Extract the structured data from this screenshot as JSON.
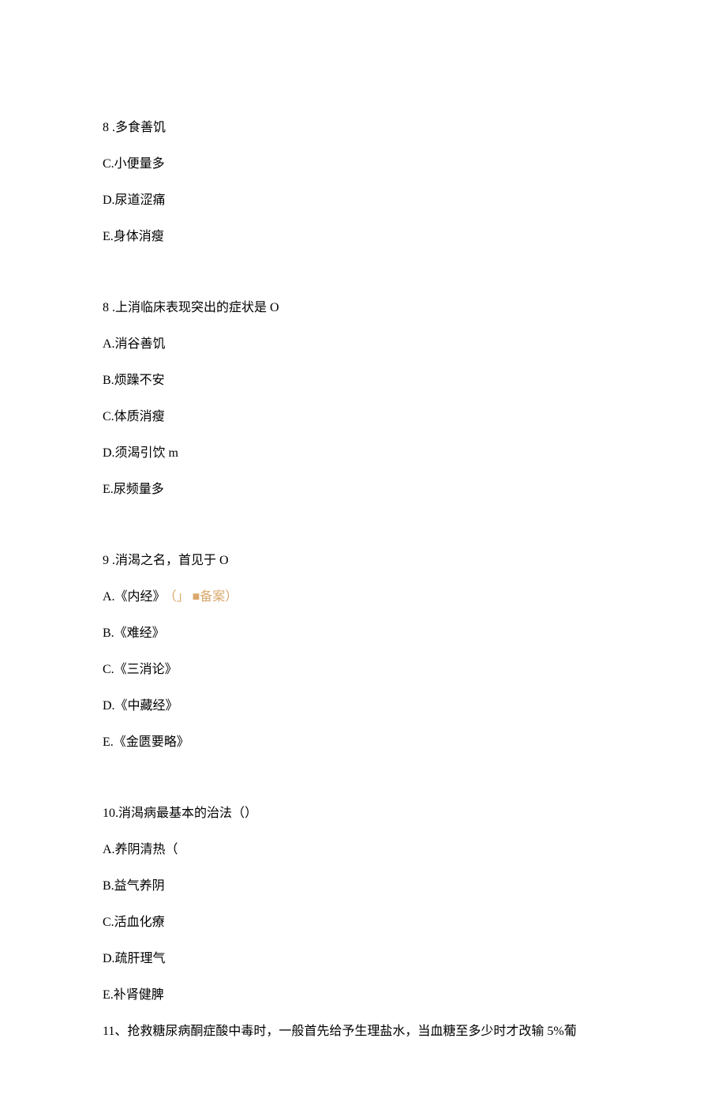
{
  "lines": [
    {
      "text": "8 .多食善饥",
      "note": null
    },
    {
      "text": "C.小便量多",
      "note": null
    },
    {
      "text": "D.尿道涩痛",
      "note": null
    },
    {
      "text": "E.身体消瘦",
      "note": null
    },
    {
      "blank": true
    },
    {
      "text": "8 .上消临床表现突出的症状是 O",
      "note": null
    },
    {
      "text": "A.消谷善饥",
      "note": null
    },
    {
      "text": "B.烦躁不安",
      "note": null
    },
    {
      "text": "C.体质消瘦",
      "note": null
    },
    {
      "text": "D.须渴引饮 m",
      "note": null
    },
    {
      "text": "E.尿频量多",
      "note": null
    },
    {
      "blank": true
    },
    {
      "text": "9 .消渴之名，首见于 O",
      "note": null
    },
    {
      "text": "A.《内经》",
      "note": "（」 ■备案）"
    },
    {
      "text": "B.《难经》",
      "note": null
    },
    {
      "text": "C.《三消论》",
      "note": null
    },
    {
      "text": "D.《中藏经》",
      "note": null
    },
    {
      "text": "E.《金匮要略》",
      "note": null
    },
    {
      "blank": true
    },
    {
      "text": "10.消渴病最基本的治法（）",
      "note": null
    },
    {
      "text": "A.养阴清热（ ",
      "note": null
    },
    {
      "text": "B.益气养阴",
      "note": null
    },
    {
      "text": "C.活血化療",
      "note": null
    },
    {
      "text": "D.疏肝理气",
      "note": null
    },
    {
      "text": "E.补肾健脾",
      "note": null
    },
    {
      "text": "11、抢救糖尿病酮症酸中毒时，一般首先给予生理盐水，当血糖至多少时才改输 5%葡",
      "note": null
    }
  ]
}
